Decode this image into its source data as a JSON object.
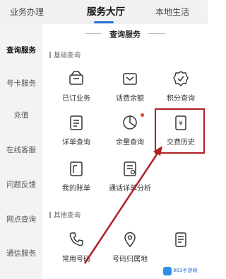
{
  "tabs": {
    "left": "业务办理",
    "center": "服务大厅",
    "right": "本地生活"
  },
  "section_title": "查询服务",
  "sidebar": {
    "items": [
      {
        "label": "查询服务",
        "active": true
      },
      {
        "label": "号卡服务",
        "active": false
      },
      {
        "label": "充值",
        "active": false
      },
      {
        "label": "在线客服",
        "active": false
      },
      {
        "label": "问题反馈",
        "active": false
      },
      {
        "label": "网点查询",
        "active": false
      },
      {
        "label": "通信服务",
        "active": false
      }
    ]
  },
  "groups": {
    "basic": {
      "label": "基础查询",
      "items": [
        {
          "label": "已订业务",
          "icon": "subscribed-box-icon"
        },
        {
          "label": "话费余额",
          "icon": "wallet-icon"
        },
        {
          "label": "积分查询",
          "icon": "points-badge-icon"
        },
        {
          "label": "详单查询",
          "icon": "detail-list-icon"
        },
        {
          "label": "余量查询",
          "icon": "pie-chart-icon"
        },
        {
          "label": "交费历史",
          "icon": "payment-history-icon"
        },
        {
          "label": "我的账单",
          "icon": "bill-icon"
        },
        {
          "label": "通话详单分析",
          "icon": "call-analysis-icon"
        }
      ]
    },
    "other": {
      "label": "其他查询",
      "items": [
        {
          "label": "常用号码",
          "icon": "phone-icon"
        },
        {
          "label": "号码归属地",
          "icon": "location-pin-icon"
        },
        {
          "label": "",
          "icon": "document-icon"
        }
      ]
    }
  },
  "watermark": "963手游网",
  "colors": {
    "accent": "#2f6fd8",
    "highlight": "#b12020",
    "notify_dot": "#d9472b"
  }
}
